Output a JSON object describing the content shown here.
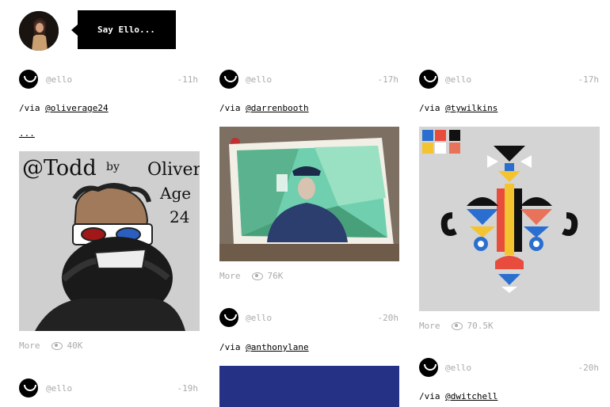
{
  "composer": {
    "say_label": "Say Ello..."
  },
  "posts": [
    {
      "handle": "@ello",
      "time": "-11h",
      "via_prefix": "/via ",
      "via_user": "@oliverage24",
      "more_link": "...",
      "more_label": "More",
      "views": "40K"
    },
    {
      "handle": "@ello",
      "time": "-17h",
      "via_prefix": "/via ",
      "via_user": "@darrenbooth",
      "more_label": "More",
      "views": "76K"
    },
    {
      "handle": "@ello",
      "time": "-17h",
      "via_prefix": "/via ",
      "via_user": "@tywilkins",
      "more_label": "More",
      "views": "70.5K"
    },
    {
      "handle": "@ello",
      "time": "-20h",
      "via_prefix": "/via ",
      "via_user": "@anthonylane"
    },
    {
      "handle": "@ello",
      "time": "-20h",
      "via_prefix": "/via ",
      "via_user": "@dwitchell"
    },
    {
      "handle": "@ello",
      "time": "-19h"
    }
  ],
  "drawing": {
    "line1": "@Todd",
    "by": "by",
    "name": "Oliver",
    "age": "Age",
    "num": "24"
  },
  "colors": {
    "accent": "#000000",
    "muted": "#aaaaaa",
    "bluebox": "#243184"
  }
}
